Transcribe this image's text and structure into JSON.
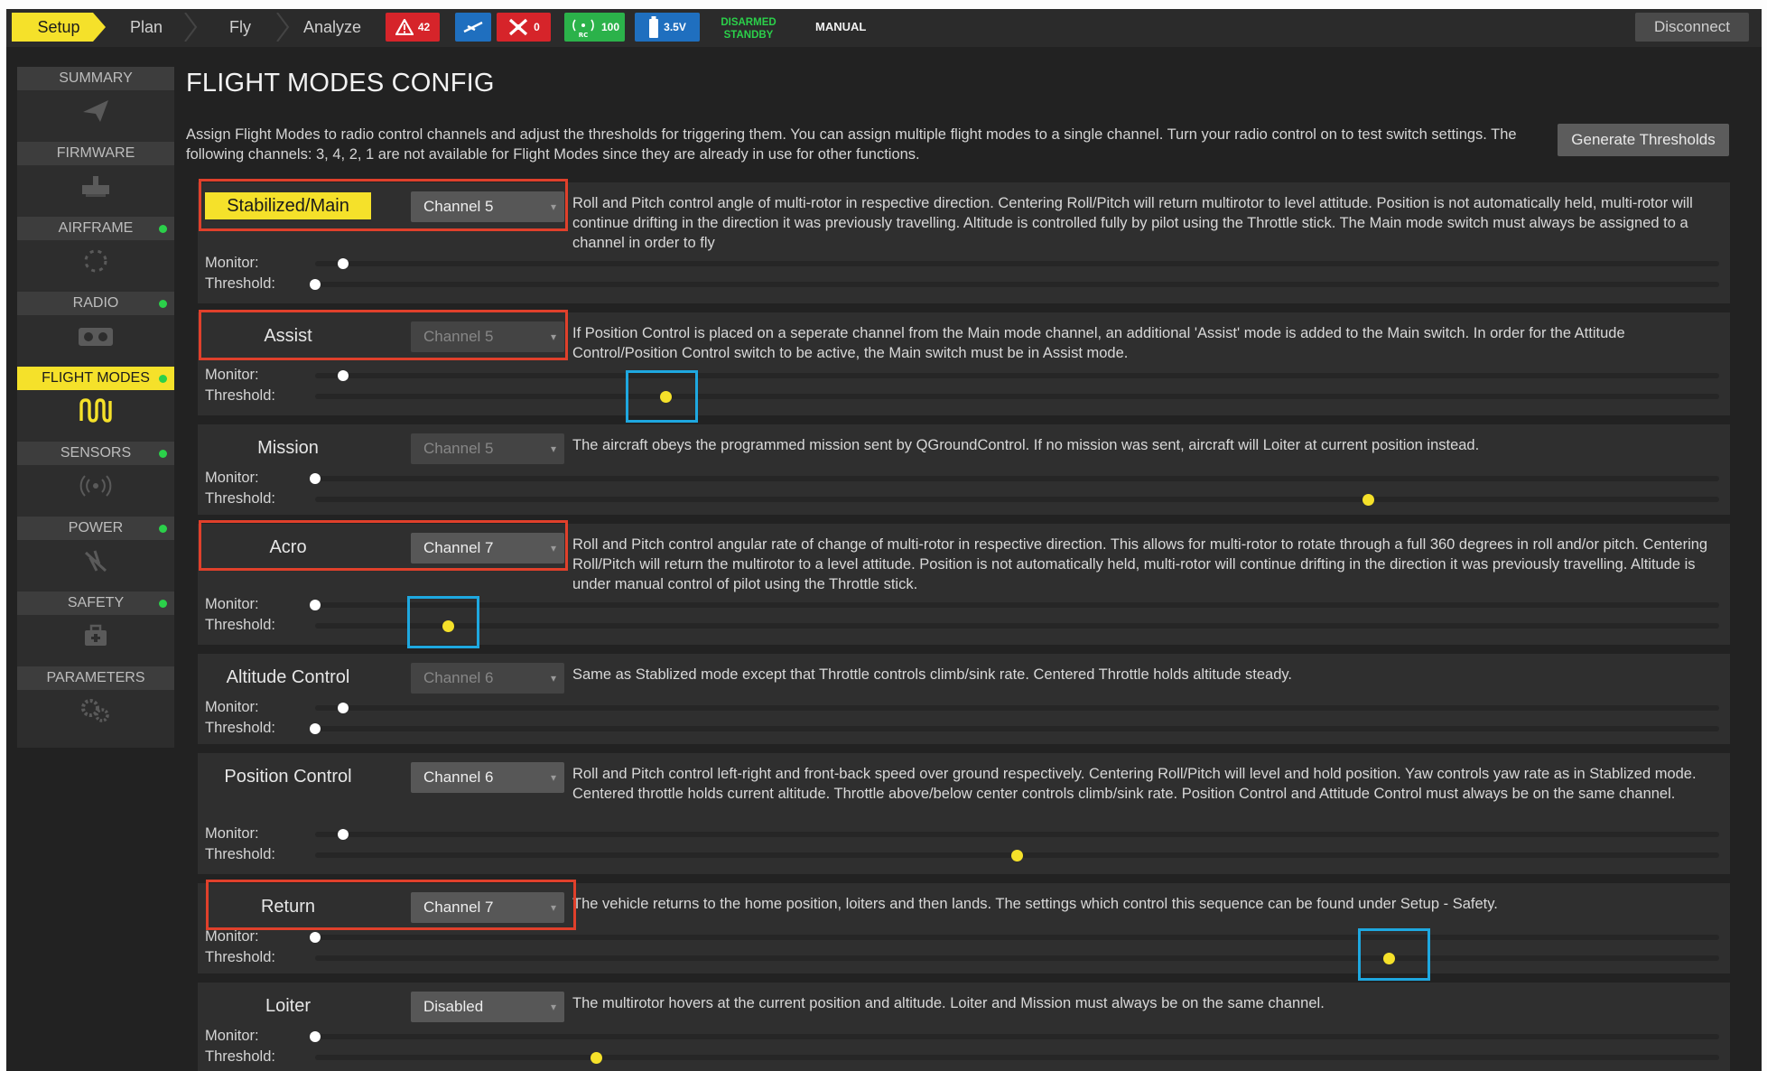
{
  "toolbar": {
    "tabs": [
      {
        "label": "Setup"
      },
      {
        "label": "Plan"
      },
      {
        "label": "Fly"
      },
      {
        "label": "Analyze"
      }
    ],
    "messages_count": "42",
    "gps_count": "0",
    "rc_rssi": "100",
    "rc_icon_label": "RC",
    "battery": "3.5V",
    "arm_state": "DISARMED",
    "vehicle_state": "STANDBY",
    "flight_mode": "MANUAL",
    "disconnect_label": "Disconnect",
    "colors": {
      "messages": "#d6242a",
      "gps": "#1f6fbf",
      "rc": "#2bb24a",
      "battery": "#1f6fbf",
      "status_text": "#2bd04a"
    }
  },
  "sidebar": {
    "items": [
      {
        "label": "SUMMARY",
        "icon": "paper-plane-icon",
        "status": false
      },
      {
        "label": "FIRMWARE",
        "icon": "firmware-icon",
        "status": false
      },
      {
        "label": "AIRFRAME",
        "icon": "airframe-icon",
        "status": true
      },
      {
        "label": "RADIO",
        "icon": "radio-icon",
        "status": true
      },
      {
        "label": "FLIGHT MODES",
        "icon": "flight-modes-icon",
        "status": true
      },
      {
        "label": "SENSORS",
        "icon": "sensors-icon",
        "status": true
      },
      {
        "label": "POWER",
        "icon": "power-icon",
        "status": true
      },
      {
        "label": "SAFETY",
        "icon": "safety-icon",
        "status": true
      },
      {
        "label": "PARAMETERS",
        "icon": "parameters-icon",
        "status": false
      }
    ]
  },
  "page": {
    "title": "FLIGHT MODES CONFIG",
    "help": "Assign Flight Modes to radio control channels and adjust the thresholds for triggering them. You can assign multiple flight modes to a single channel. Turn your radio control on to test switch settings. The following channels: 3, 4, 2, 1 are not available for Flight Modes since they are already in use for other functions.",
    "generate_label": "Generate Thresholds",
    "monitor_label": "Monitor:",
    "threshold_label": "Threshold:"
  },
  "modes": [
    {
      "name": "Stabilized/Main",
      "channel": "Channel 5",
      "desc": "Roll and Pitch control angle of multi-rotor in respective direction. Centering Roll/Pitch will return multirotor to level attitude. Position is not automatically held, multi-rotor will continue drifting in the direction it was previously travelling. Altitude is controlled fully by pilot using the Throttle stick. The Main mode switch must always be assigned to a channel in order to fly",
      "monitor": 0.02,
      "threshold": 0.0
    },
    {
      "name": "Assist",
      "channel": "Channel 5",
      "desc": "If Position Control is placed on a seperate channel from the Main mode channel, an additional 'Assist' mode is added to the Main switch. In order for the Attitude Control/Position Control switch to be active, the Main switch must be in Assist mode.",
      "monitor": 0.02,
      "threshold": 0.25
    },
    {
      "name": "Mission",
      "channel": "Channel 5",
      "desc": "The aircraft obeys the programmed mission sent by QGroundControl. If no mission was sent, aircraft will Loiter at current position instead.",
      "monitor": 0.0,
      "threshold": 0.75
    },
    {
      "name": "Acro",
      "channel": "Channel 7",
      "desc": "Roll and Pitch control angular rate of change of multi-rotor in respective direction. This allows for multi-rotor to rotate through a full 360 degrees in roll and/or pitch. Centering Roll/Pitch will return the multirotor to a level attitude. Position is not automatically held, multi-rotor will continue drifting in the direction it was previously travelling. Altitude is under manual control of pilot using the Throttle stick.",
      "monitor": 0.0,
      "threshold": 0.095
    },
    {
      "name": "Altitude Control",
      "channel": "Channel 6",
      "desc": "Same as Stablized mode except that Throttle controls climb/sink rate. Centered Throttle holds altitude steady.",
      "monitor": 0.02,
      "threshold": 0.0
    },
    {
      "name": "Position Control",
      "channel": "Channel 6",
      "desc": "Roll and Pitch control left-right and front-back speed over ground respectively. Centering Roll/Pitch will level and hold position. Yaw controls yaw rate as in Stablized mode. Centered throttle holds current altitude. Throttle above/below center controls climb/sink rate. Position Control and Attitude Control must always be on the same channel.",
      "monitor": 0.02,
      "threshold": 0.5
    },
    {
      "name": "Return",
      "channel": "Channel 7",
      "desc": "The vehicle returns to the home position, loiters and then lands. The settings which control this sequence can be found under Setup - Safety.",
      "monitor": 0.0,
      "threshold": 0.765
    },
    {
      "name": "Loiter",
      "channel": "Disabled",
      "desc": "The multirotor hovers at the current position and altitude. Loiter and Mission must always be on the same channel.",
      "monitor": 0.0,
      "threshold": 0.2
    }
  ]
}
